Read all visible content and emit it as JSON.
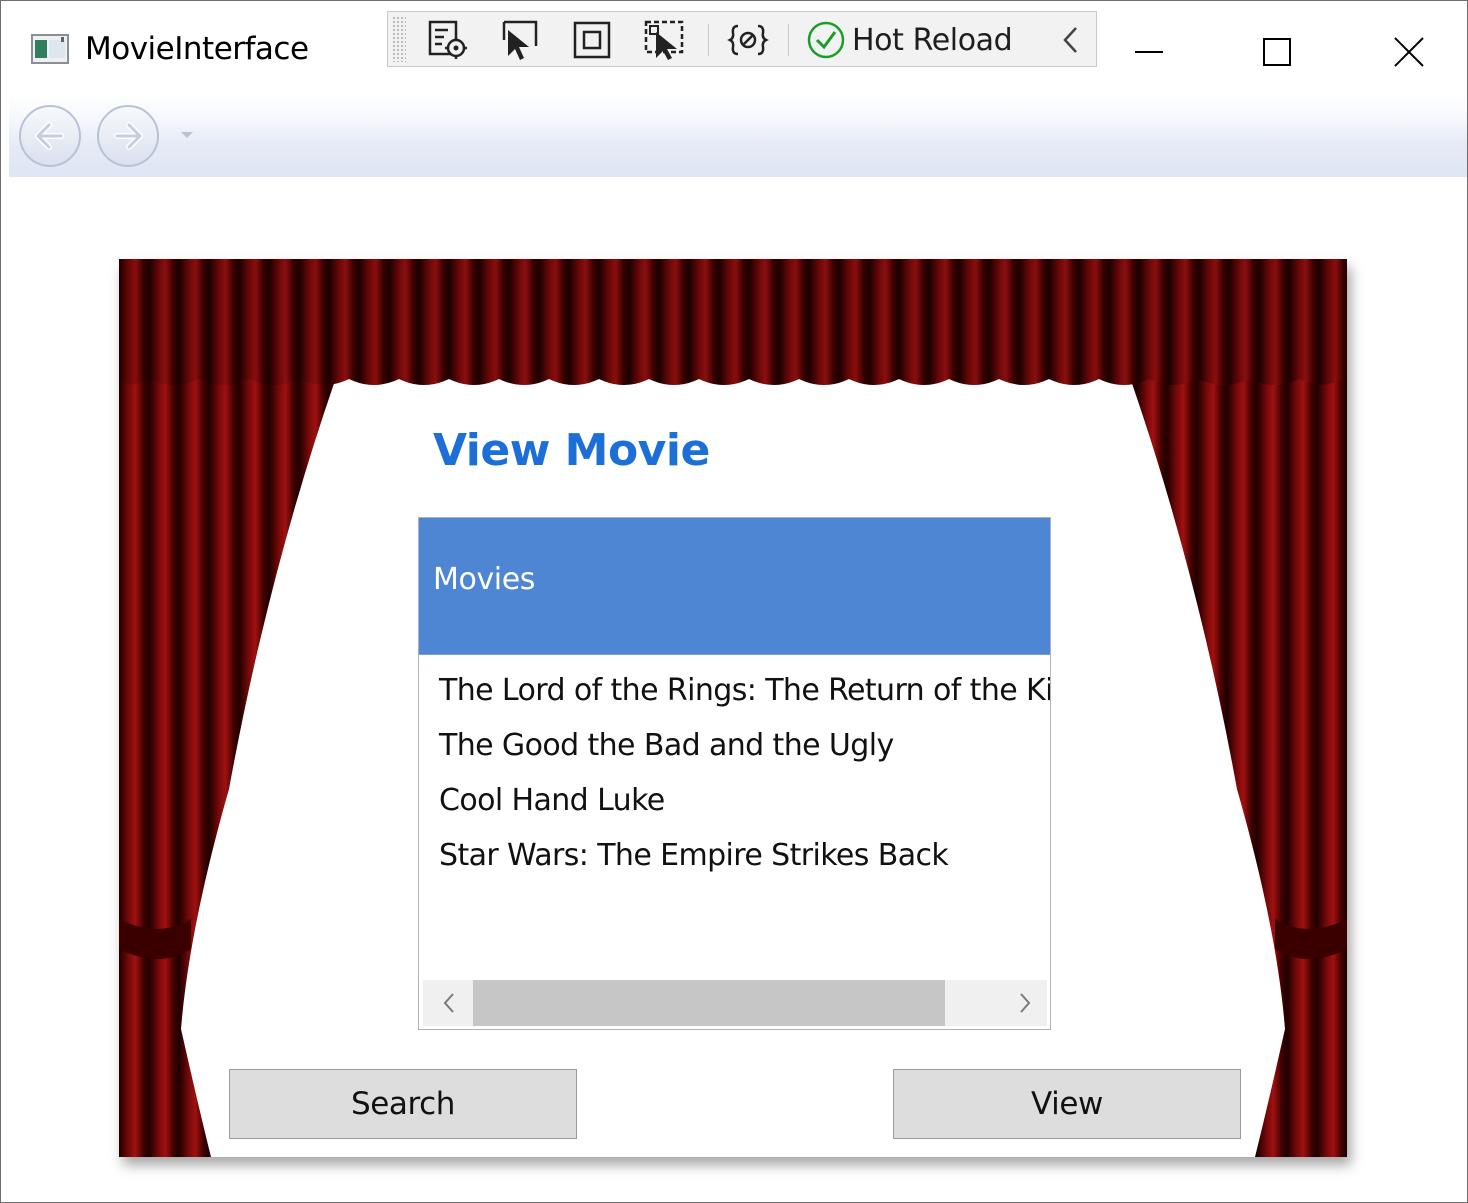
{
  "window": {
    "title": "MovieInterface"
  },
  "devbar": {
    "hot_reload_label": "Hot Reload"
  },
  "page": {
    "heading": "View Movie"
  },
  "listview": {
    "header": "Movies",
    "items": [
      "The Lord of the Rings: The Return of the King",
      "The Good the Bad and the Ugly",
      "Cool Hand Luke",
      "Star Wars: The Empire Strikes Back"
    ]
  },
  "buttons": {
    "search": "Search",
    "view": "View"
  },
  "colors": {
    "heading": "#1c6fd6",
    "list_header": "#4f86d4",
    "curtain": "#8b0a0a",
    "hot_reload_check": "#1a9e2a"
  },
  "icons": {
    "app": "app-window-icon",
    "devbar": [
      "live-visual-tree-icon",
      "select-element-icon",
      "display-layout-adorners-icon",
      "track-focus-icon",
      "binding-failures-icon",
      "hot-reload-check-icon",
      "collapse-chevron-icon"
    ],
    "nav": [
      "back-arrow-icon",
      "forward-arrow-icon",
      "history-dropdown-icon"
    ],
    "window": [
      "minimize-icon",
      "maximize-icon",
      "close-icon"
    ]
  }
}
